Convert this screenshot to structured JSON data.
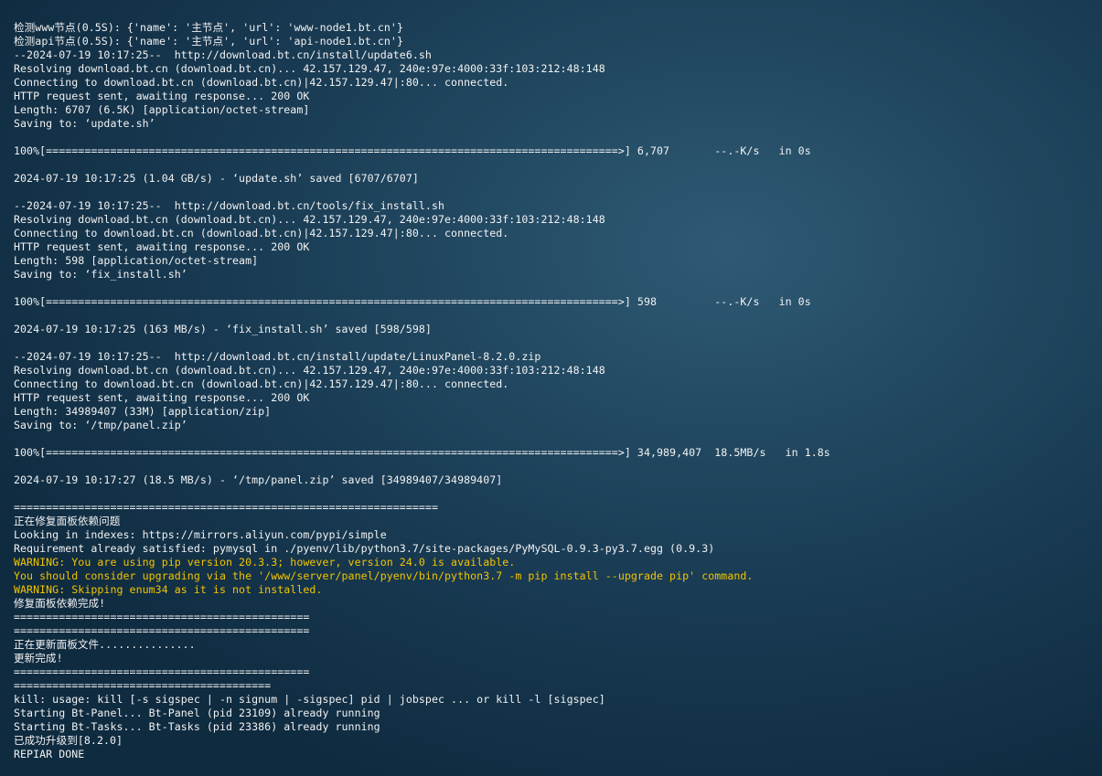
{
  "terminal": {
    "lines": [
      {
        "text": "检测www节点(0.5S): {'name': '主节点', 'url': 'www-node1.bt.cn'}",
        "level": "normal"
      },
      {
        "text": "检测api节点(0.5S): {'name': '主节点', 'url': 'api-node1.bt.cn'}",
        "level": "normal"
      },
      {
        "text": "--2024-07-19 10:17:25--  http://download.bt.cn/install/update6.sh",
        "level": "normal"
      },
      {
        "text": "Resolving download.bt.cn (download.bt.cn)... 42.157.129.47, 240e:97e:4000:33f:103:212:48:148",
        "level": "normal"
      },
      {
        "text": "Connecting to download.bt.cn (download.bt.cn)|42.157.129.47|:80... connected.",
        "level": "normal"
      },
      {
        "text": "HTTP request sent, awaiting response... 200 OK",
        "level": "normal"
      },
      {
        "text": "Length: 6707 (6.5K) [application/octet-stream]",
        "level": "normal"
      },
      {
        "text": "Saving to: ‘update.sh’",
        "level": "normal"
      },
      {
        "text": "",
        "level": "normal"
      },
      {
        "text": "100%[=========================================================================================>] 6,707       --.-K/s   in 0s",
        "level": "normal"
      },
      {
        "text": "",
        "level": "normal"
      },
      {
        "text": "2024-07-19 10:17:25 (1.04 GB/s) - ‘update.sh’ saved [6707/6707]",
        "level": "normal"
      },
      {
        "text": "",
        "level": "normal"
      },
      {
        "text": "--2024-07-19 10:17:25--  http://download.bt.cn/tools/fix_install.sh",
        "level": "normal"
      },
      {
        "text": "Resolving download.bt.cn (download.bt.cn)... 42.157.129.47, 240e:97e:4000:33f:103:212:48:148",
        "level": "normal"
      },
      {
        "text": "Connecting to download.bt.cn (download.bt.cn)|42.157.129.47|:80... connected.",
        "level": "normal"
      },
      {
        "text": "HTTP request sent, awaiting response... 200 OK",
        "level": "normal"
      },
      {
        "text": "Length: 598 [application/octet-stream]",
        "level": "normal"
      },
      {
        "text": "Saving to: ‘fix_install.sh’",
        "level": "normal"
      },
      {
        "text": "",
        "level": "normal"
      },
      {
        "text": "100%[=========================================================================================>] 598         --.-K/s   in 0s",
        "level": "normal"
      },
      {
        "text": "",
        "level": "normal"
      },
      {
        "text": "2024-07-19 10:17:25 (163 MB/s) - ‘fix_install.sh’ saved [598/598]",
        "level": "normal"
      },
      {
        "text": "",
        "level": "normal"
      },
      {
        "text": "--2024-07-19 10:17:25--  http://download.bt.cn/install/update/LinuxPanel-8.2.0.zip",
        "level": "normal"
      },
      {
        "text": "Resolving download.bt.cn (download.bt.cn)... 42.157.129.47, 240e:97e:4000:33f:103:212:48:148",
        "level": "normal"
      },
      {
        "text": "Connecting to download.bt.cn (download.bt.cn)|42.157.129.47|:80... connected.",
        "level": "normal"
      },
      {
        "text": "HTTP request sent, awaiting response... 200 OK",
        "level": "normal"
      },
      {
        "text": "Length: 34989407 (33M) [application/zip]",
        "level": "normal"
      },
      {
        "text": "Saving to: ‘/tmp/panel.zip’",
        "level": "normal"
      },
      {
        "text": "",
        "level": "normal"
      },
      {
        "text": "100%[=========================================================================================>] 34,989,407  18.5MB/s   in 1.8s",
        "level": "normal"
      },
      {
        "text": "",
        "level": "normal"
      },
      {
        "text": "2024-07-19 10:17:27 (18.5 MB/s) - ‘/tmp/panel.zip’ saved [34989407/34989407]",
        "level": "normal"
      },
      {
        "text": "",
        "level": "normal"
      },
      {
        "text": "==================================================================",
        "level": "normal"
      },
      {
        "text": "正在修复面板依赖问题",
        "level": "normal"
      },
      {
        "text": "Looking in indexes: https://mirrors.aliyun.com/pypi/simple",
        "level": "normal"
      },
      {
        "text": "Requirement already satisfied: pymysql in ./pyenv/lib/python3.7/site-packages/PyMySQL-0.9.3-py3.7.egg (0.9.3)",
        "level": "normal"
      },
      {
        "text": "WARNING: You are using pip version 20.3.3; however, version 24.0 is available.",
        "level": "warning"
      },
      {
        "text": "You should consider upgrading via the '/www/server/panel/pyenv/bin/python3.7 -m pip install --upgrade pip' command.",
        "level": "warning"
      },
      {
        "text": "WARNING: Skipping enum34 as it is not installed.",
        "level": "warning"
      },
      {
        "text": "修复面板依赖完成!",
        "level": "normal"
      },
      {
        "text": "==============================================",
        "level": "normal"
      },
      {
        "text": "==============================================",
        "level": "normal"
      },
      {
        "text": "正在更新面板文件...............",
        "level": "normal"
      },
      {
        "text": "更新完成!",
        "level": "normal"
      },
      {
        "text": "==============================================",
        "level": "normal"
      },
      {
        "text": "========================================",
        "level": "normal"
      },
      {
        "text": "kill: usage: kill [-s sigspec | -n signum | -sigspec] pid | jobspec ... or kill -l [sigspec]",
        "level": "normal"
      },
      {
        "text": "Starting Bt-Panel... Bt-Panel (pid 23109) already running",
        "level": "normal"
      },
      {
        "text": "Starting Bt-Tasks... Bt-Tasks (pid 23386) already running",
        "level": "normal"
      },
      {
        "text": "已成功升级到[8.2.0]",
        "level": "normal"
      },
      {
        "text": "REPIAR DONE",
        "level": "normal"
      }
    ]
  },
  "colors": {
    "text": "#f2f2f2",
    "warning": "#f2c400",
    "background_center": "#2f5a74",
    "background_edge": "#0f2b40"
  }
}
